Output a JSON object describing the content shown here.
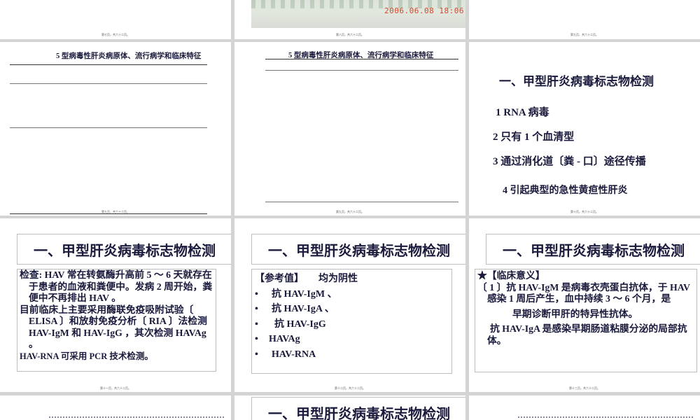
{
  "slides": [
    {
      "id": "s-top-left",
      "page": "第七页，共六十二页。"
    },
    {
      "id": "s-top-mid",
      "photo_timestamp": "2006.06.08 18:06",
      "page": "第八页，共六十二页。"
    },
    {
      "id": "s-top-right",
      "page": "第九页，共六十二页。"
    },
    {
      "id": "s-mid-left",
      "title": "5 型病毒性肝炎病原体、流行病学和临床特征",
      "page": "第九页，共六十二页。"
    },
    {
      "id": "s-mid-mid",
      "title": "5 型病毒性肝炎病原体、流行病学和临床特征",
      "page": "第九页，共六十二页。"
    },
    {
      "id": "s-mid-right",
      "title": "一、甲型肝炎病毒标志物检测",
      "points": [
        "1 RNA 病毒",
        "2  只有 1 个血清型",
        "3  通过消化道〔粪 - 口〕途径传播",
        "4  引起典型的急性黄疸性肝炎"
      ],
      "page": "第十页，共六十二页。"
    },
    {
      "id": "s-row3-left",
      "title": "一、甲型肝炎病毒标志物检测",
      "paras": [
        "检查:  HAV 常在转氨酶升高前 5 ～ 6 天就存在于患者的血液和粪便中。发病 2 周开始，粪便中不再排出 HAV 。",
        "目前临床上主要采用酶联免疫吸附试验〔 ELISA 〕和放射免疫分析〔 RIA 〕法检测 HAV-IgM 和 HAV-IgG ，其次检测 HAVAg 。",
        "HAV-RNA 可采用 PCR 技术检测。"
      ],
      "page": "第十一页，共六十二页。"
    },
    {
      "id": "s-row3-mid",
      "title": "一、甲型肝炎病毒标志物检测",
      "ref_label": "【参考值】",
      "ref_value": "均为阴性",
      "bullet_char": "•",
      "bullets": [
        "抗 HAV-IgM 、",
        "抗 HAV-IgA 、",
        " 抗 HAV-IgG",
        "HAVAg",
        " HAV-RNA"
      ],
      "page": "第十二页，共六十二页。"
    },
    {
      "id": "s-row3-right",
      "title": "一、甲型肝炎病毒标志物检测",
      "lines": [
        "★【临床意义】",
        "〔 1 〕抗 HAV-IgM    是病毒衣壳蛋白抗体，于 HAV 感染 1 周后产生，血中持续 3 ～ 6 个月，是",
        "早期诊断甲肝的特异性抗体。",
        "抗 HAV-IgA 是感染早期肠道粘膜分泌的局部抗体。"
      ],
      "page": "第十三页，共六十二页。"
    },
    {
      "id": "s-row4-mid",
      "title": "一、甲型肝炎病毒标志物检测"
    }
  ]
}
